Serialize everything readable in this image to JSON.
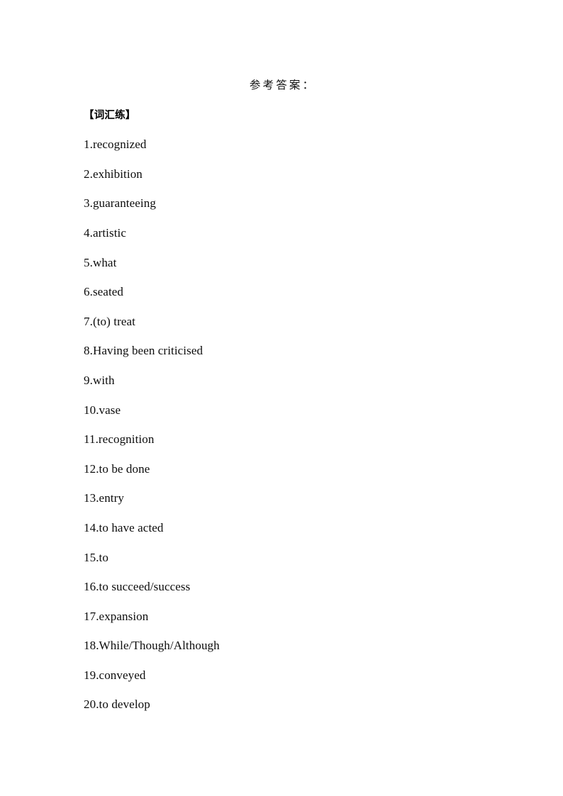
{
  "document": {
    "title": "参考答案：",
    "section_heading": "【词汇练】",
    "answers": [
      {
        "text": "1.recognized"
      },
      {
        "text": "2.exhibition"
      },
      {
        "text": "3.guaranteeing"
      },
      {
        "text": "4.artistic"
      },
      {
        "text": "5.what"
      },
      {
        "text": "6.seated"
      },
      {
        "text": "7.(to) treat"
      },
      {
        "text": "8.Having been criticised"
      },
      {
        "text": "9.with"
      },
      {
        "text": "10.vase"
      },
      {
        "text": "11.recognition"
      },
      {
        "text": "12.to be done"
      },
      {
        "text": "13.entry"
      },
      {
        "text": "14.to have acted"
      },
      {
        "text": "15.to"
      },
      {
        "text": "16.to succeed/success"
      },
      {
        "text": "17.expansion"
      },
      {
        "text": "18.While/Though/Although"
      },
      {
        "text": "19.conveyed"
      },
      {
        "text": "20.to develop"
      }
    ]
  }
}
